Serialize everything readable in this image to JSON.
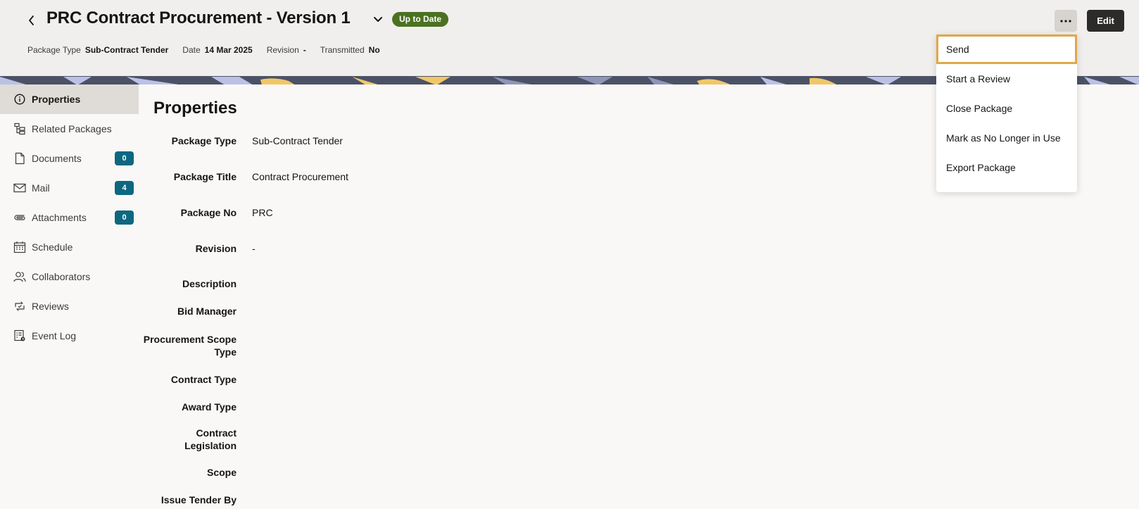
{
  "header": {
    "title": "PRC Contract Procurement - Version 1",
    "status": "Up to Date",
    "meta": [
      {
        "label": "Package Type",
        "value": "Sub-Contract Tender"
      },
      {
        "label": "Date",
        "value": "14 Mar 2025"
      },
      {
        "label": "Revision",
        "value": "-"
      },
      {
        "label": "Transmitted",
        "value": "No"
      }
    ],
    "edit_label": "Edit"
  },
  "sidebar": {
    "items": [
      {
        "label": "Properties",
        "icon": "info-icon"
      },
      {
        "label": "Related Packages",
        "icon": "hierarchy-icon"
      },
      {
        "label": "Documents",
        "icon": "document-icon",
        "count": "0"
      },
      {
        "label": "Mail",
        "icon": "mail-icon",
        "count": "4"
      },
      {
        "label": "Attachments",
        "icon": "paperclip-icon",
        "count": "0"
      },
      {
        "label": "Schedule",
        "icon": "calendar-icon"
      },
      {
        "label": "Collaborators",
        "icon": "people-icon"
      },
      {
        "label": "Reviews",
        "icon": "review-icon"
      },
      {
        "label": "Event Log",
        "icon": "event-log-icon"
      }
    ]
  },
  "main": {
    "title": "Properties",
    "fields": [
      {
        "label": "Package Type",
        "value": "Sub-Contract Tender"
      },
      {
        "label": "Package Title",
        "value": "Contract Procurement"
      },
      {
        "label": "Package No",
        "value": "PRC"
      },
      {
        "label": "Revision",
        "value": "-"
      },
      {
        "label": "Description",
        "value": ""
      },
      {
        "label": "Bid Manager",
        "value": ""
      },
      {
        "label": "Procurement Scope Type",
        "value": ""
      },
      {
        "label": "Contract Type",
        "value": ""
      },
      {
        "label": "Award Type",
        "value": ""
      },
      {
        "label": "Contract Legislation",
        "value": ""
      },
      {
        "label": "Scope",
        "value": ""
      },
      {
        "label": "Issue Tender By",
        "value": ""
      }
    ]
  },
  "menu": {
    "items": [
      "Send",
      "Start a Review",
      "Close Package",
      "Mark as No Longer in Use",
      "Export Package"
    ]
  },
  "colors": {
    "status_badge": "#4b7122",
    "count_badge": "#0e6780",
    "focus_outline": "#e0a847"
  }
}
